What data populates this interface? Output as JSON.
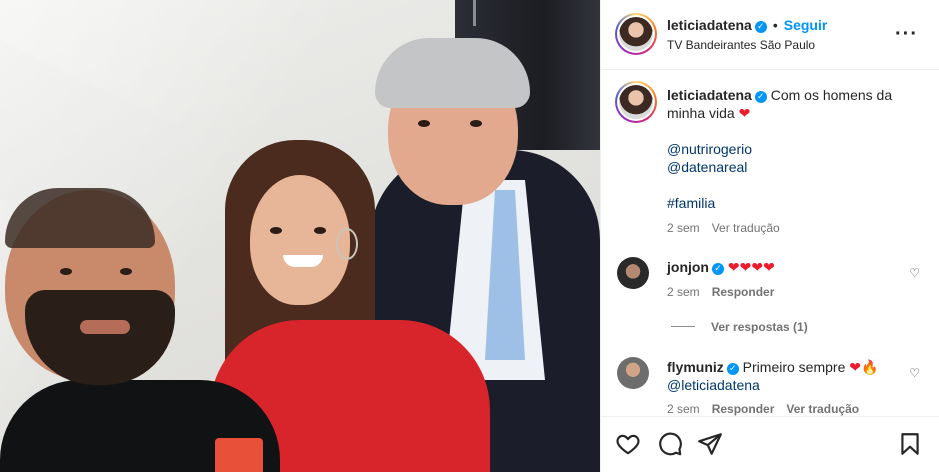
{
  "post": {
    "author": "leticiadatena",
    "follow_label": "Seguir",
    "separator": "•",
    "location": "TV Bandeirantes São Paulo",
    "more_label": "···"
  },
  "caption": {
    "author": "leticiadatena",
    "text_line1": "Com os homens da",
    "text_line2": "minha vida",
    "heart": "❤",
    "mention1": "@nutrirogerio",
    "mention2": "@datenareal",
    "hashtag": "#familia",
    "time": "2 sem",
    "translate_label": "Ver tradução"
  },
  "comments": [
    {
      "author": "jonjon",
      "text": "❤❤❤❤",
      "time": "2 sem",
      "reply_label": "Responder",
      "view_replies_label": "Ver respostas (1)"
    },
    {
      "author": "flymuniz",
      "text": "Primeiro sempre",
      "emoji": "❤🔥",
      "mention": "@leticiadatena",
      "time": "2 sem",
      "reply_label": "Responder",
      "translate_label": "Ver tradução"
    }
  ],
  "icons": {
    "verified": "✓",
    "like_small": "♡"
  },
  "colors": {
    "follow_blue": "#0095f6",
    "link_blue": "#00376b",
    "heart_red": "#ed1b2e"
  }
}
